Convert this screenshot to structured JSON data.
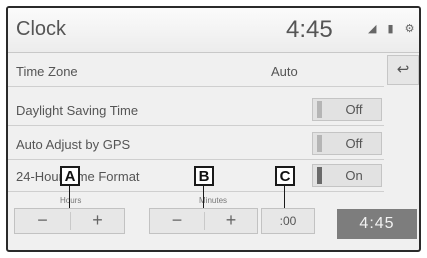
{
  "header": {
    "title": "Clock",
    "time": "4:45",
    "status_icons": "◢ ▮ ⚙"
  },
  "back_button": {
    "icon": "↩",
    "icon_name": "back-icon"
  },
  "settings": [
    {
      "label": "Time Zone",
      "value": "Auto"
    },
    {
      "label": "Daylight Saving Time",
      "toggle": "Off"
    },
    {
      "label": "Auto Adjust by GPS",
      "toggle": "Off"
    },
    {
      "label": "24-Hour Time Format",
      "toggle": "On"
    }
  ],
  "hours": {
    "label": "Hours",
    "minus": "−",
    "plus": "+"
  },
  "minutes": {
    "label": "Minutes",
    "minus": "−",
    "plus": "+"
  },
  "reset_minutes": {
    "label": ":00"
  },
  "time_display": "4:45",
  "callouts": {
    "a": "A",
    "b": "B",
    "c": "C"
  }
}
